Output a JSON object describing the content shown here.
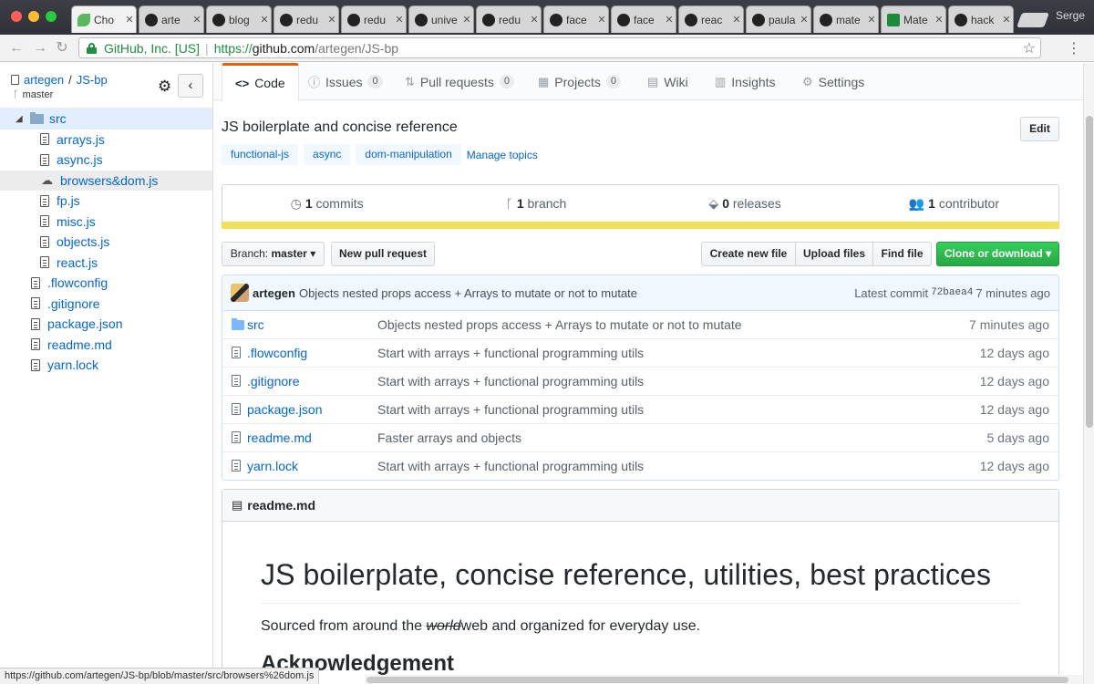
{
  "browser": {
    "tabs": [
      {
        "label": "Cho",
        "icon": "leaf-icon"
      },
      {
        "label": "arte",
        "icon": "github-icon"
      },
      {
        "label": "blog",
        "icon": "github-icon"
      },
      {
        "label": "redu",
        "icon": "github-icon"
      },
      {
        "label": "redu",
        "icon": "github-icon"
      },
      {
        "label": "unive",
        "icon": "github-icon"
      },
      {
        "label": "redu",
        "icon": "github-icon"
      },
      {
        "label": "face",
        "icon": "github-icon"
      },
      {
        "label": "face",
        "icon": "github-icon"
      },
      {
        "label": "reac",
        "icon": "github-icon"
      },
      {
        "label": "paula",
        "icon": "github-icon"
      },
      {
        "label": "mate",
        "icon": "github-icon"
      },
      {
        "label": "Mate",
        "icon": "material-icon"
      },
      {
        "label": "hack",
        "icon": "github-icon"
      }
    ],
    "profile": "Serge",
    "ev_label": "GitHub, Inc. [US]",
    "url_proto": "https://",
    "url_host": "github.com",
    "url_path": "/artegen/JS-bp",
    "status_url": "https://github.com/artegen/JS-bp/blob/master/src/browsers%26dom.js"
  },
  "sidebar": {
    "owner": "artegen",
    "repo": "JS-bp",
    "branch": "master",
    "folder": "src",
    "children": [
      "arrays.js",
      "async.js",
      "browsers&dom.js",
      "fp.js",
      "misc.js",
      "objects.js",
      "react.js"
    ],
    "root_files": [
      ".flowconfig",
      ".gitignore",
      "package.json",
      "readme.md",
      "yarn.lock"
    ]
  },
  "reponav": {
    "code": "Code",
    "issues": "Issues",
    "issues_count": "0",
    "pulls": "Pull requests",
    "pulls_count": "0",
    "projects": "Projects",
    "projects_count": "0",
    "wiki": "Wiki",
    "insights": "Insights",
    "settings": "Settings"
  },
  "repo": {
    "description": "JS boilerplate and concise reference",
    "edit_label": "Edit",
    "topics": [
      "functional-js",
      "async",
      "dom-manipulation"
    ],
    "manage_topics": "Manage topics",
    "commits_num": "1",
    "commits_label": "commits",
    "branch_num": "1",
    "branch_label": "branch",
    "releases_num": "0",
    "releases_label": "releases",
    "contributor_num": "1",
    "contributor_label": "contributor",
    "language_color": "#f1e05a"
  },
  "toolbar": {
    "branch_prefix": "Branch:",
    "branch_name": "master",
    "new_pr": "New pull request",
    "create_file": "Create new file",
    "upload_files": "Upload files",
    "find_file": "Find file",
    "clone": "Clone or download"
  },
  "commit": {
    "author": "artegen",
    "message": "Objects nested props access + Arrays to mutate or not to mutate",
    "latest_label": "Latest commit",
    "sha": "72baea4",
    "age": "7 minutes ago"
  },
  "files": [
    {
      "type": "folder",
      "name": "src",
      "message": "Objects nested props access + Arrays to mutate or not to mutate",
      "age": "7 minutes ago"
    },
    {
      "type": "file",
      "name": ".flowconfig",
      "message": "Start with arrays + functional programming utils",
      "age": "12 days ago"
    },
    {
      "type": "file",
      "name": ".gitignore",
      "message": "Start with arrays + functional programming utils",
      "age": "12 days ago"
    },
    {
      "type": "file",
      "name": "package.json",
      "message": "Start with arrays + functional programming utils",
      "age": "12 days ago"
    },
    {
      "type": "file",
      "name": "readme.md",
      "message": "Faster arrays and objects",
      "age": "5 days ago"
    },
    {
      "type": "file",
      "name": "yarn.lock",
      "message": "Start with arrays + functional programming utils",
      "age": "12 days ago"
    }
  ],
  "readme": {
    "filename": "readme.md",
    "h1": "JS boilerplate, concise reference, utilities, best practices",
    "p_before": "Sourced from around the ",
    "p_struck": "world",
    "p_after": "web and organized for everyday use.",
    "h2": "Acknowledgement"
  }
}
